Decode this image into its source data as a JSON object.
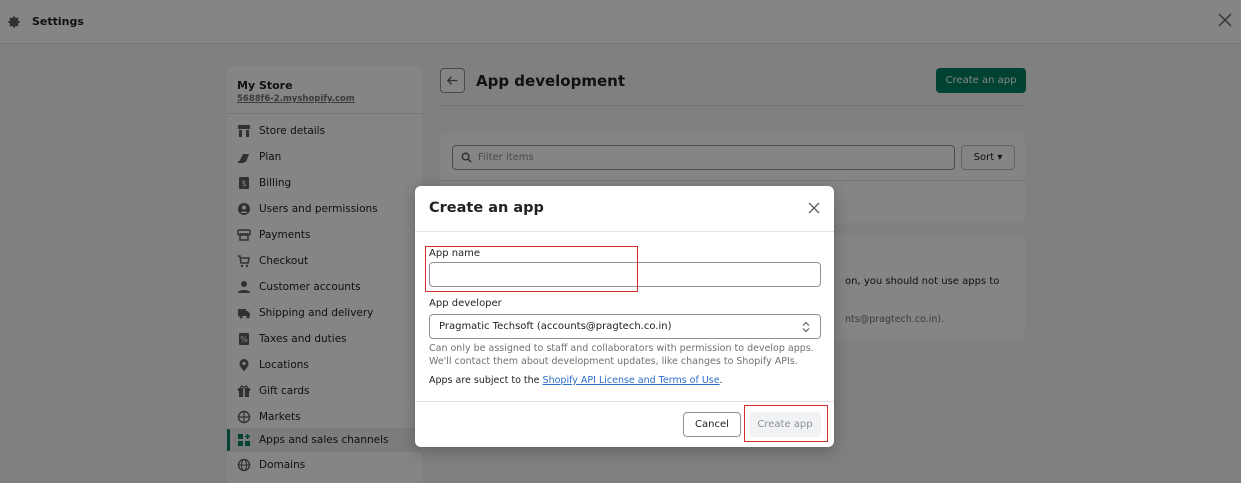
{
  "topbar": {
    "title": "Settings",
    "icon": "gear-icon",
    "close_icon": "close-icon"
  },
  "sidebar": {
    "store_name": "My Store",
    "store_url": "5688f6-2.myshopify.com",
    "items": [
      {
        "label": "Store details",
        "icon": "store-icon"
      },
      {
        "label": "Plan",
        "icon": "plan-icon"
      },
      {
        "label": "Billing",
        "icon": "billing-icon"
      },
      {
        "label": "Users and permissions",
        "icon": "user-circle-icon"
      },
      {
        "label": "Payments",
        "icon": "payments-icon"
      },
      {
        "label": "Checkout",
        "icon": "cart-icon"
      },
      {
        "label": "Customer accounts",
        "icon": "person-icon"
      },
      {
        "label": "Shipping and delivery",
        "icon": "truck-icon"
      },
      {
        "label": "Taxes and duties",
        "icon": "taxes-icon"
      },
      {
        "label": "Locations",
        "icon": "location-pin-icon"
      },
      {
        "label": "Gift cards",
        "icon": "gift-icon"
      },
      {
        "label": "Markets",
        "icon": "globe-icon"
      },
      {
        "label": "Apps and sales channels",
        "icon": "apps-icon",
        "active": true
      },
      {
        "label": "Domains",
        "icon": "domains-icon"
      }
    ]
  },
  "main": {
    "title": "App development",
    "create_button": "Create an app",
    "filter_placeholder": "Filter items",
    "sort_label": "Sort",
    "notice_line1": "on, you should not use apps to",
    "notice_line2": "nts@pragtech.co.in)."
  },
  "modal": {
    "title": "Create an app",
    "app_name_label": "App name",
    "app_name_value": "",
    "app_developer_label": "App developer",
    "app_developer_value": "Pragmatic Techsoft (accounts@pragtech.co.in)",
    "help_line1": "Can only be assigned to staff and collaborators with permission to develop apps.",
    "help_line2": "We'll contact them about development updates, like changes to Shopify APIs.",
    "terms_prefix": "Apps are subject to the ",
    "terms_link": "Shopify API License and Terms of Use",
    "terms_suffix": ".",
    "cancel_label": "Cancel",
    "create_label": "Create app"
  },
  "colors": {
    "primary": "#008060",
    "highlight": "#d82c2c",
    "link": "#2c6ecb"
  }
}
